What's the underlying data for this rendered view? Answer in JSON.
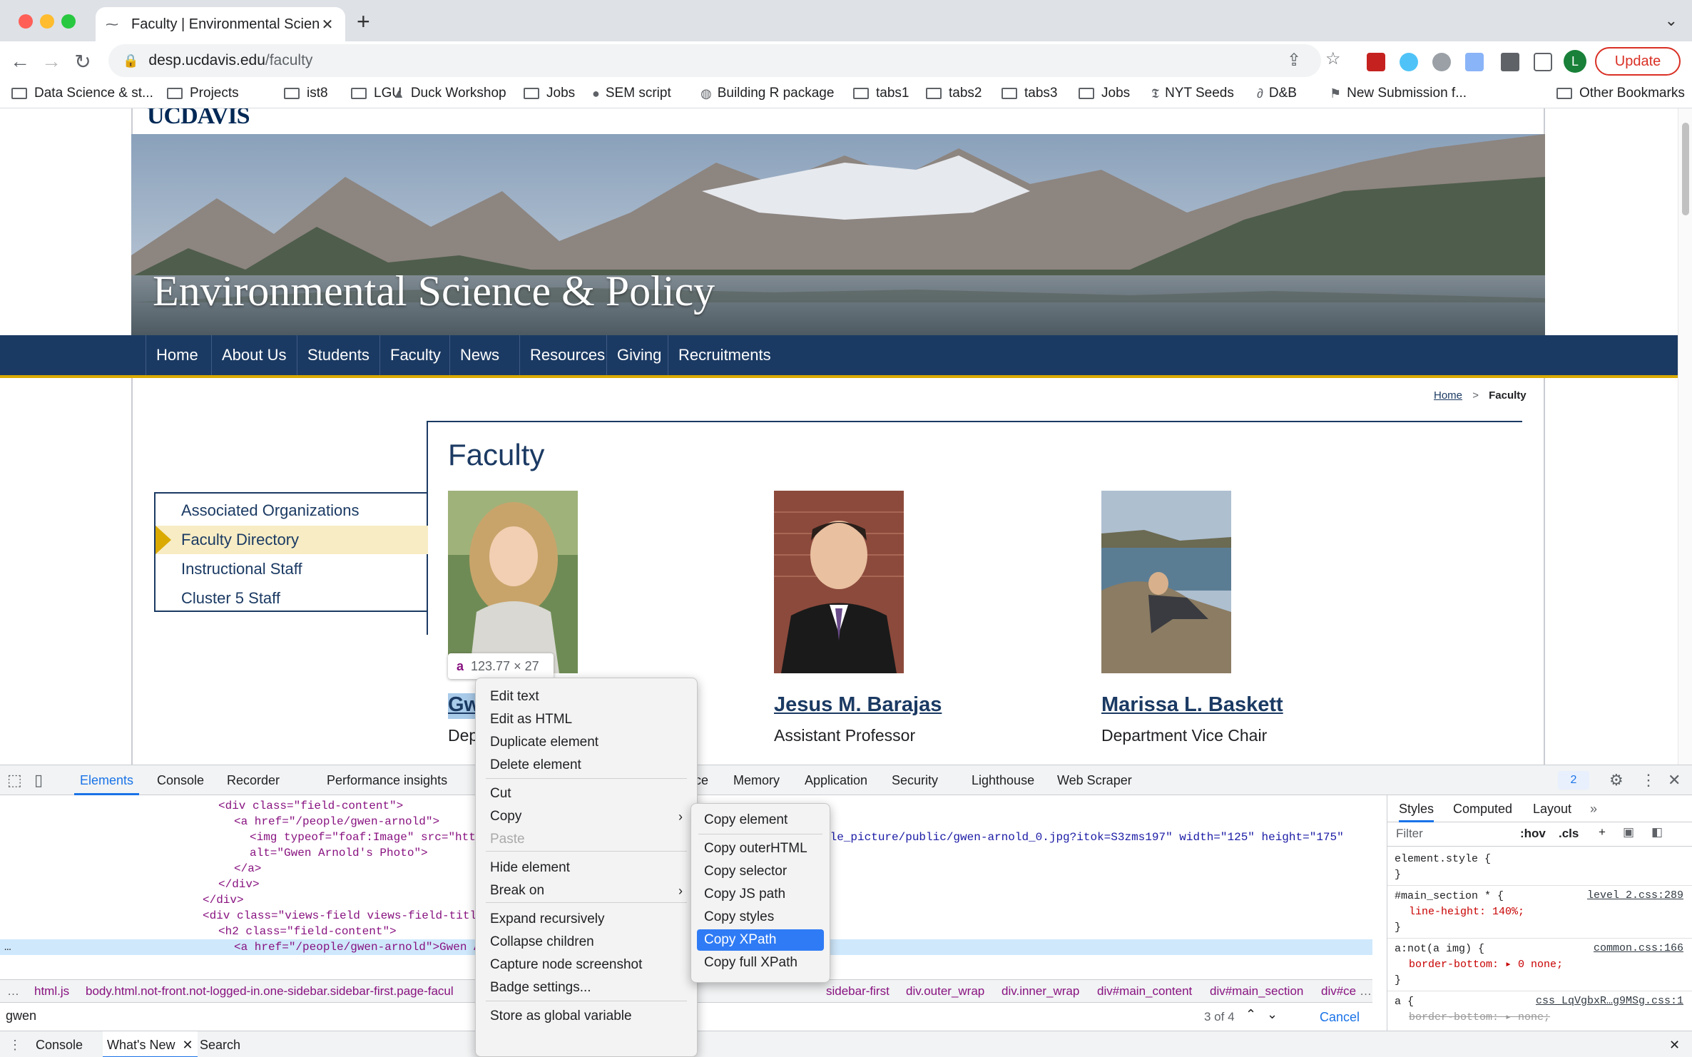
{
  "window": {
    "tab_title": "Faculty | Environmental Science",
    "tab_close": "✕",
    "new_tab": "+",
    "tabs_menu": "⌄"
  },
  "toolbar": {
    "url_host": "desp.ucdavis.edu",
    "url_path": "/faculty",
    "profile_letter": "L",
    "update_label": "Update"
  },
  "bookmarks": [
    {
      "label": "Data Science & st...",
      "icon": "folder-icon"
    },
    {
      "label": "Projects",
      "icon": "folder-icon"
    },
    {
      "label": "ist8",
      "icon": "folder-icon"
    },
    {
      "label": "LGU",
      "icon": "folder-icon"
    },
    {
      "label": "Duck Workshop",
      "icon": "drive-icon"
    },
    {
      "label": "Jobs",
      "icon": "folder-icon"
    },
    {
      "label": "SEM script",
      "icon": "github-icon"
    },
    {
      "label": "Building R package",
      "icon": "globe-icon"
    },
    {
      "label": "tabs1",
      "icon": "folder-icon"
    },
    {
      "label": "tabs2",
      "icon": "folder-icon"
    },
    {
      "label": "tabs3",
      "icon": "folder-icon"
    },
    {
      "label": "Jobs",
      "icon": "folder-icon"
    },
    {
      "label": "NYT Seeds",
      "icon": "nyt-icon"
    },
    {
      "label": "D&B",
      "icon": "link-icon"
    },
    {
      "label": "New Submission f...",
      "icon": "bookmark-icon"
    },
    {
      "label": "Other Bookmarks",
      "icon": "folder-icon"
    }
  ],
  "site": {
    "logo": "UCDAVIS",
    "banner_title": "Environmental Science & Policy",
    "nav": [
      "Home",
      "About Us",
      "Students",
      "Faculty",
      "News",
      "Resources",
      "Giving",
      "Recruitments"
    ],
    "breadcrumb": {
      "home": "Home",
      "sep": ">",
      "current": "Faculty"
    },
    "page_heading": "Faculty",
    "sidebar": [
      "Associated Organizations",
      "Faculty Directory",
      "Instructional Staff",
      "Cluster 5 Staff"
    ],
    "sidebar_active_index": 1,
    "faculty": [
      {
        "name": "Gw",
        "title": "Dep"
      },
      {
        "name": "Jesus M. Barajas",
        "title": "Assistant Professor"
      },
      {
        "name": "Marissa L. Baskett",
        "title": "Department Vice Chair"
      }
    ],
    "inspect_tooltip": {
      "tag": "a",
      "size": "123.77 × 27"
    }
  },
  "devtools": {
    "tabs": [
      "Elements",
      "Console",
      "Recorder",
      "Performance insights",
      "ce",
      "Memory",
      "Application",
      "Security",
      "Lighthouse",
      "Web Scraper"
    ],
    "active_tab": "Elements",
    "issues_count": "2",
    "dom_lines": [
      {
        "indent": 0,
        "html": "<div class=\"field-content\">"
      },
      {
        "indent": 1,
        "html": "<a href=\"/people/gwen-arnold\">"
      },
      {
        "indent": 2,
        "html": "<img typeof=\"foaf:Image\" src=\"https"
      },
      {
        "indent": 2,
        "html": "alt=\"Gwen Arnold's Photo\">"
      },
      {
        "indent": 1,
        "html": "</a>"
      },
      {
        "indent": 0,
        "html": "</div>"
      },
      {
        "indent": -1,
        "html": "</div>"
      },
      {
        "indent": -1,
        "html": "<div class=\"views-field views-field-titl"
      },
      {
        "indent": 0,
        "html": "<h2 class=\"field-content\">"
      },
      {
        "indent": 1,
        "html": "<a href=\"/people/gwen-arnold\">Gwen A"
      }
    ],
    "img_src_tail": "ile_picture/public/gwen-arnold_0.jpg?itok=S3zms197\" width=\"125\" height=\"175\"",
    "breadcrumbs": [
      "html.js",
      "body.html.not-front.not-logged-in.one-sidebar.sidebar-first.page-facul",
      "sidebar-first",
      "div.outer_wrap",
      "div.inner_wrap",
      "div#main_content",
      "div#main_section",
      "div#ce"
    ],
    "search_query": "gwen",
    "search_count": "3 of 4",
    "search_cancel": "Cancel",
    "drawer_tabs": [
      "Console",
      "What's New",
      "Search"
    ],
    "styles_tabs": [
      "Styles",
      "Computed",
      "Layout"
    ],
    "styles_filter": "Filter",
    "styles_hov": ":hov",
    "styles_cls": ".cls",
    "rules": [
      {
        "selector": "element.style {",
        "source": "",
        "decl": ""
      },
      {
        "selector": "#main_section * {",
        "source": "level_2.css:289",
        "decl": "line-height: 140%;"
      },
      {
        "selector": "a:not(a img) {",
        "source": "common.css:166",
        "decl": "border-bottom: ▸ 0 none;"
      },
      {
        "selector": "a {",
        "source": "css_LqVgbxR…g9MSg.css:1",
        "decl": "border-bottom: ▸ none;"
      }
    ]
  },
  "context_menu": {
    "items": [
      "Edit text",
      "Edit as HTML",
      "Duplicate element",
      "Delete element",
      "Cut",
      "Copy",
      "Paste",
      "Hide element",
      "Break on",
      "Expand recursively",
      "Collapse children",
      "Capture node screenshot",
      "Badge settings...",
      "Store as global variable"
    ],
    "submenu": [
      "Copy element",
      "Copy outerHTML",
      "Copy selector",
      "Copy JS path",
      "Copy styles",
      "Copy XPath",
      "Copy full XPath"
    ],
    "submenu_active": "Copy XPath"
  },
  "colors": {
    "nav_bg": "#1b3a63",
    "gold": "#daaa00",
    "link": "#1b3a63",
    "menu_active": "#2f7bf5"
  }
}
